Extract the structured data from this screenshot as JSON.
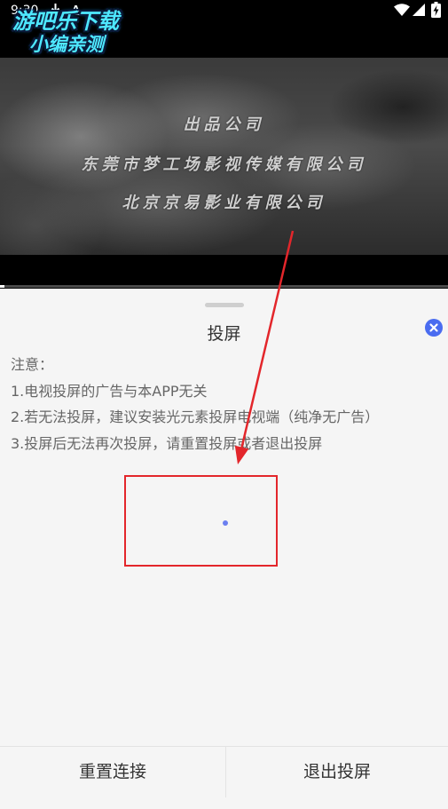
{
  "status_bar": {
    "time": "9:30",
    "badge_letter": "A",
    "notification_icons": [
      "download-icon",
      "a-icon"
    ],
    "system_icons": [
      "wifi-icon",
      "signal-icon",
      "battery-icon"
    ]
  },
  "watermark": {
    "line1": "游吧乐下载",
    "line2": "小编亲测"
  },
  "video": {
    "credits": [
      "出品公司",
      "东莞市梦工场影视传媒有限公司",
      "北京京易影业有限公司"
    ],
    "progress": 0.01
  },
  "cast_sheet": {
    "title": "投屏",
    "close_icon": "close-icon",
    "notes": [
      "注意：",
      "1.电视投屏的广告与本APP无关",
      "2.若无法投屏，建议安装光元素投屏电视端（纯净无广告）",
      "3.投屏后无法再次投屏，请重置投屏或者退出投屏"
    ],
    "loading_icon": "loading-dot-icon",
    "buttons": {
      "reset": "重置连接",
      "exit": "退出投屏"
    }
  },
  "colors": {
    "accent": "#4a6cf0",
    "annotation": "#e3262b",
    "sheet_bg": "#f5f5f5"
  }
}
